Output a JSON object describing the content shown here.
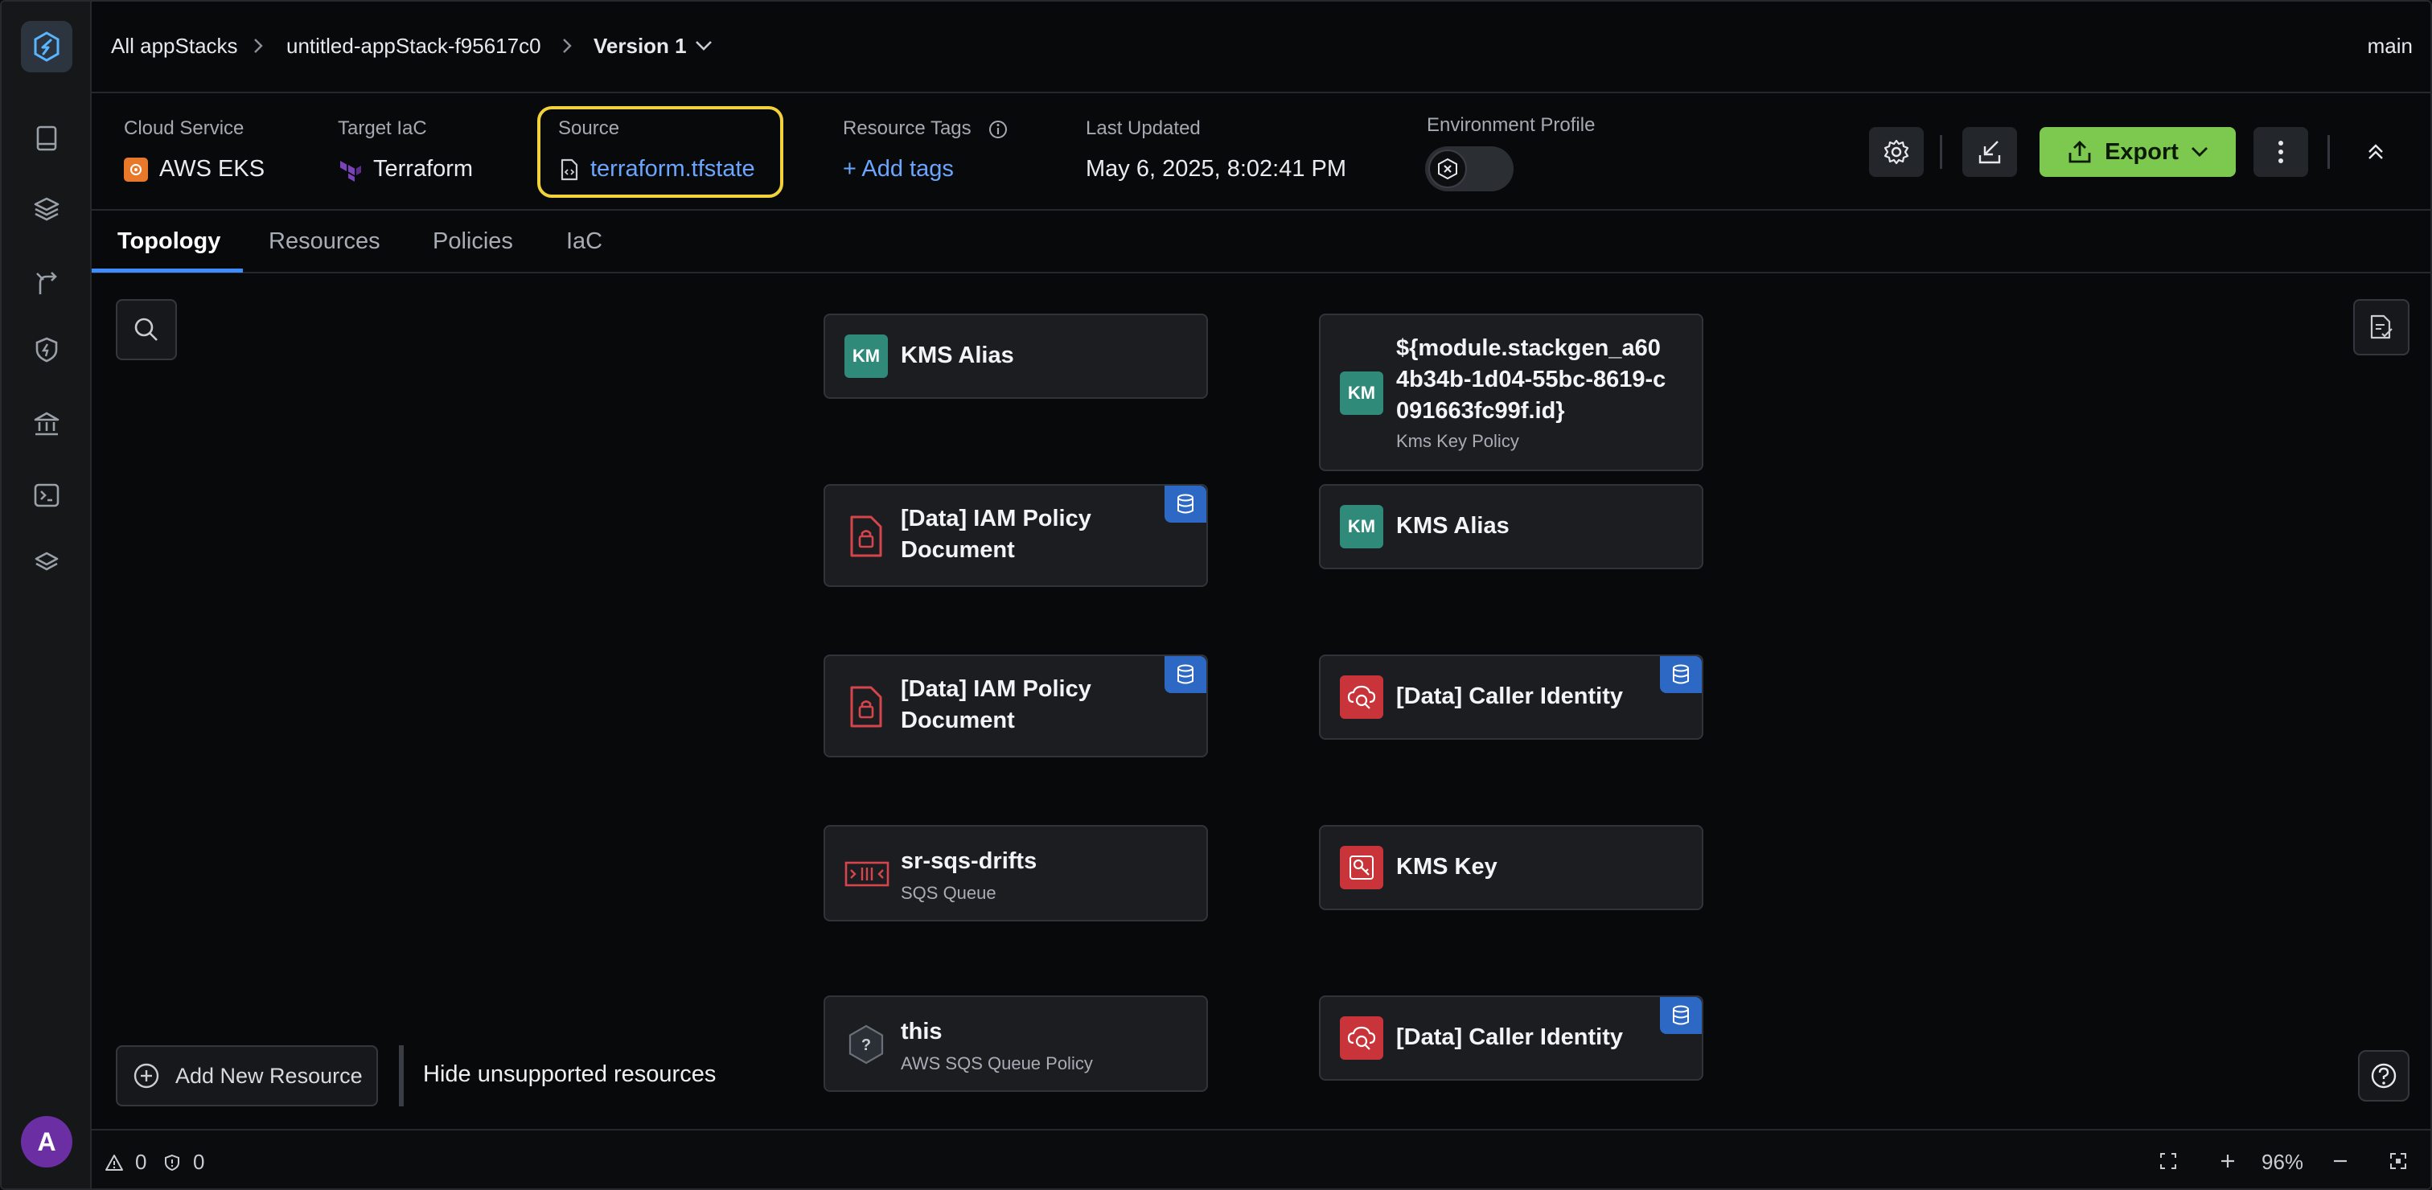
{
  "breadcrumbs": {
    "root": "All appStacks",
    "stack": "untitled-appStack-f95617c0",
    "version": "Version 1"
  },
  "branch": "main",
  "info": {
    "cloud_label": "Cloud Service",
    "cloud_value": "AWS EKS",
    "iac_label": "Target IaC",
    "iac_value": "Terraform",
    "source_label": "Source",
    "source_value": "terraform.tfstate",
    "tags_label": "Resource Tags",
    "tags_action": "+ Add tags",
    "updated_label": "Last Updated",
    "updated_value": "May 6, 2025, 8:02:41 PM",
    "env_label": "Environment Profile"
  },
  "toolbar": {
    "export_label": "Export"
  },
  "tabs": [
    "Topology",
    "Resources",
    "Policies",
    "IaC"
  ],
  "nodes": {
    "kms_alias_1": {
      "icon": "KM",
      "title": "KMS Alias"
    },
    "kms_key_policy": {
      "icon": "KM",
      "title": "${module.stackgen_a604b34b-1d04-55bc-8619-c091663fc99f.id}",
      "subtitle": "Kms Key Policy"
    },
    "iam_policy_1": {
      "title": "[Data] IAM Policy Document"
    },
    "kms_alias_2": {
      "icon": "KM",
      "title": "KMS Alias"
    },
    "iam_policy_2": {
      "title": "[Data] IAM Policy Document"
    },
    "caller_identity_1": {
      "title": "[Data] Caller Identity"
    },
    "sqs_queue": {
      "title": "sr-sqs-drifts",
      "subtitle": "SQS Queue"
    },
    "kms_key": {
      "title": "KMS Key"
    },
    "sqs_policy": {
      "icon": "?",
      "title": "this",
      "subtitle": "AWS SQS Queue Policy"
    },
    "caller_identity_2": {
      "title": "[Data] Caller Identity"
    }
  },
  "canvas": {
    "add_resource_label": "Add New Resource",
    "hide_unsupported_label": "Hide unsupported resources"
  },
  "footer": {
    "warnings": "0",
    "errors": "0",
    "zoom": "96%"
  },
  "user": {
    "avatar_initial": "A"
  },
  "colors": {
    "accent": "#3f8cff",
    "export": "#7dc84e",
    "highlight": "#f1d23a",
    "kms": "#2f8a7a",
    "aws_red": "#c9343a"
  }
}
